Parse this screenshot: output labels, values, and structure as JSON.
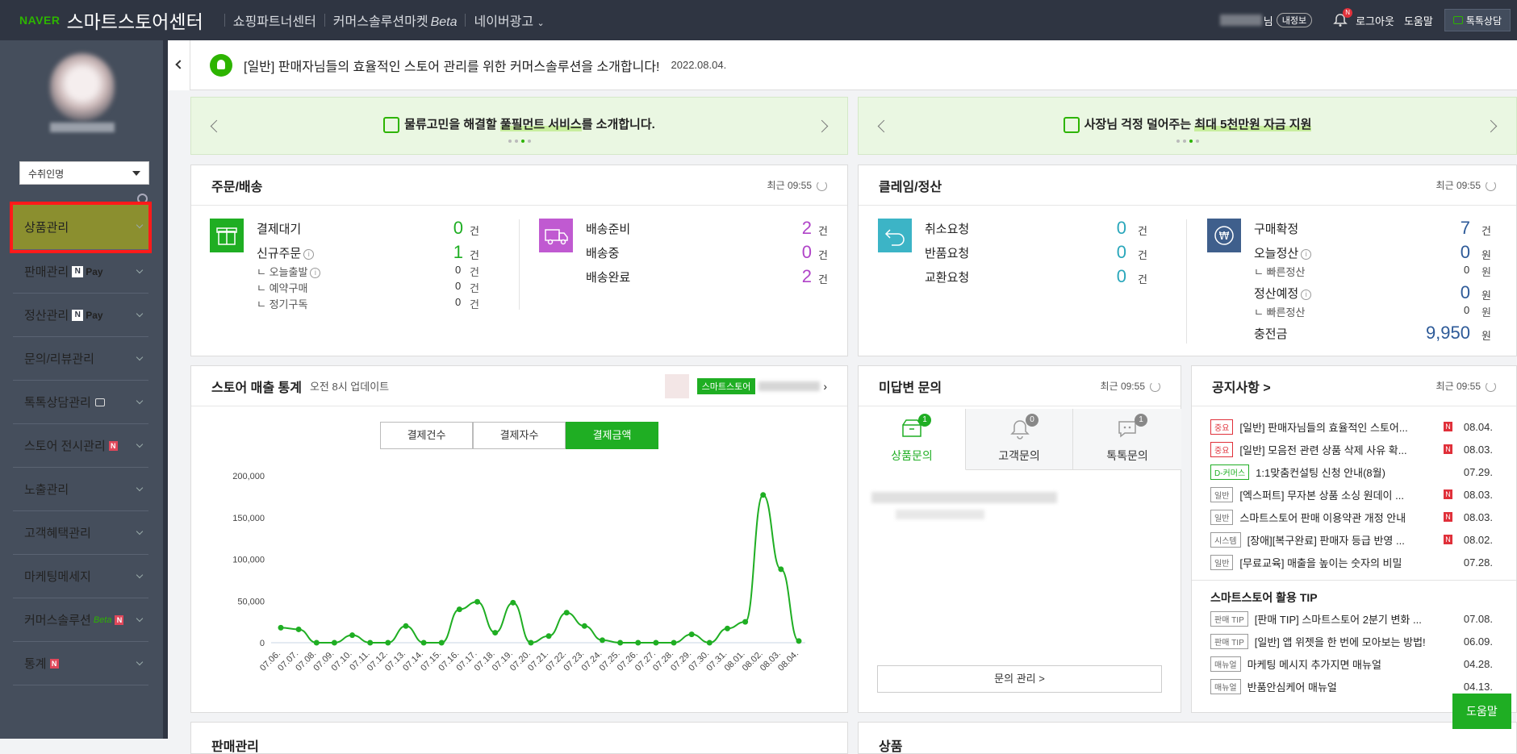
{
  "topbar": {
    "logo": "NAVER",
    "title": "스마트스토어센터",
    "nav": [
      "쇼핑파트너센터",
      "커머스솔루션마켓",
      "네이버광고"
    ],
    "beta": "Beta",
    "user_suffix": "님",
    "my_info": "내정보",
    "bell_badge": "N",
    "logout": "로그아웃",
    "help": "도움말",
    "talk": "톡톡상담"
  },
  "sidebar": {
    "store_select": "수취인명",
    "menu": [
      {
        "label": "상품관리"
      },
      {
        "label": "판매관리",
        "pay": "Pay"
      },
      {
        "label": "정산관리",
        "pay": "Pay"
      },
      {
        "label": "문의/리뷰관리"
      },
      {
        "label": "톡톡상담관리"
      },
      {
        "label": "스토어 전시관리",
        "new": "N"
      },
      {
        "label": "노출관리"
      },
      {
        "label": "고객혜택관리"
      },
      {
        "label": "마케팅메세지"
      },
      {
        "label": "커머스솔루션",
        "beta": "Beta",
        "new": "N"
      },
      {
        "label": "통계",
        "new": "N"
      }
    ],
    "n_badge": "N"
  },
  "notice_bar": {
    "text": "[일반] 판매자님들의 효율적인 스토어 관리를 위한 커머스솔루션을 소개합니다!",
    "date": "2022.08.04."
  },
  "banners": [
    {
      "pre": "물류고민을 해결할 ",
      "hl": "풀필먼트 서비스",
      "post": "를 소개합니다."
    },
    {
      "pre": "사장님 걱정 덜어주는 ",
      "hl": "최대 5천만원 자금 지원",
      "post": ""
    }
  ],
  "orders": {
    "title": "주문/배송",
    "recent": "최근 09:55",
    "payment_wait": {
      "label": "결제대기",
      "value": "0",
      "unit": "건"
    },
    "new_order": {
      "label": "신규주문",
      "value": "1",
      "unit": "건"
    },
    "today_ship": {
      "label": "오늘출발",
      "value": "0",
      "unit": "건"
    },
    "reserve": {
      "label": "예약구매",
      "value": "0",
      "unit": "건"
    },
    "subscription": {
      "label": "정기구독",
      "value": "0",
      "unit": "건"
    },
    "ready": {
      "label": "배송준비",
      "value": "2",
      "unit": "건"
    },
    "shipping": {
      "label": "배송중",
      "value": "0",
      "unit": "건"
    },
    "done": {
      "label": "배송완료",
      "value": "2",
      "unit": "건"
    }
  },
  "claims": {
    "title": "클레임/정산",
    "recent": "최근 09:55",
    "cancel": {
      "label": "취소요청",
      "value": "0",
      "unit": "건"
    },
    "return": {
      "label": "반품요청",
      "value": "0",
      "unit": "건"
    },
    "exchange": {
      "label": "교환요청",
      "value": "0",
      "unit": "건"
    },
    "confirm": {
      "label": "구매확정",
      "value": "7",
      "unit": "건"
    },
    "today_settle": {
      "label": "오늘정산",
      "value": "0",
      "unit": "원"
    },
    "fast1": {
      "label": "빠른정산",
      "value": "0",
      "unit": "원"
    },
    "planned": {
      "label": "정산예정",
      "value": "0",
      "unit": "원"
    },
    "fast2": {
      "label": "빠른정산",
      "value": "0",
      "unit": "원"
    },
    "charge": {
      "label": "충전금",
      "value": "9,950",
      "unit": "원"
    }
  },
  "sales": {
    "title": "스토어 매출 통계",
    "subtitle": "오전 8시 업데이트",
    "store_tag": "스마트스토어",
    "tabs": [
      "결제건수",
      "결제자수",
      "결제금액"
    ],
    "active_tab": 2
  },
  "chart_data": {
    "type": "line",
    "title": "",
    "xlabel": "",
    "ylabel": "",
    "ylim": [
      0,
      200000
    ],
    "yticks": [
      "0",
      "50,000",
      "100,000",
      "150,000",
      "200,000"
    ],
    "ytick_values": [
      0,
      50000,
      100000,
      150000,
      200000
    ],
    "categories": [
      "07.06.",
      "07.07.",
      "07.08.",
      "07.09.",
      "07.10.",
      "07.11.",
      "07.12.",
      "07.13.",
      "07.14.",
      "07.15.",
      "07.16.",
      "07.17.",
      "07.18.",
      "07.19.",
      "07.20.",
      "07.21.",
      "07.22.",
      "07.23.",
      "07.24.",
      "07.25.",
      "07.26.",
      "07.27.",
      "07.28.",
      "07.29.",
      "07.30.",
      "07.31.",
      "08.01.",
      "08.02.",
      "08.03.",
      "08.04."
    ],
    "values": [
      18000,
      16000,
      0,
      0,
      9000,
      0,
      0,
      20000,
      0,
      0,
      40000,
      49000,
      12000,
      48000,
      0,
      8000,
      36000,
      20000,
      3000,
      0,
      0,
      0,
      0,
      10000,
      0,
      17000,
      25000,
      177000,
      88000,
      2000
    ],
    "color": "#1fae23"
  },
  "inquiries": {
    "title": "미답변 문의",
    "recent": "최근 09:55",
    "tabs": [
      {
        "label": "상품문의",
        "count": "1"
      },
      {
        "label": "고객문의",
        "count": "0"
      },
      {
        "label": "톡톡문의",
        "count": "1"
      }
    ],
    "manage": "문의 관리 >"
  },
  "notices": {
    "title": "공지사항 >",
    "recent": "최근 09:55",
    "items": [
      {
        "tag": "중요",
        "tagtype": "red",
        "text": "[일반] 판매자님들의 효율적인 스토어...",
        "new": "N",
        "date": "08.04."
      },
      {
        "tag": "중요",
        "tagtype": "red",
        "text": "[일반] 모음전 관련 상품 삭제 사유 확...",
        "new": "N",
        "date": "08.03."
      },
      {
        "tag": "D-커머스",
        "tagtype": "green",
        "text": "1:1맞춤컨설팅 신청 안내(8월)",
        "new": "",
        "date": "07.29."
      },
      {
        "tag": "일반",
        "tagtype": "gray",
        "text": "[엑스퍼트] 무자본 상품 소싱 원데이 ...",
        "new": "N",
        "date": "08.03."
      },
      {
        "tag": "일반",
        "tagtype": "gray",
        "text": "스마트스토어 판매 이용약관 개정 안내",
        "new": "N",
        "date": "08.03."
      },
      {
        "tag": "시스템",
        "tagtype": "gray",
        "text": "[장애][복구완료] 판매자 등급 반영 ...",
        "new": "N",
        "date": "08.02."
      },
      {
        "tag": "일반",
        "tagtype": "gray",
        "text": "[무료교육] 매출을 높이는 숫자의 비밀",
        "new": "",
        "date": "07.28."
      }
    ],
    "tip_title": "스마트스토어 활용 TIP",
    "tips": [
      {
        "tag": "판매 TIP",
        "text": "[판매 TIP] 스마트스토어 2분기 변화 ...",
        "date": "07.08."
      },
      {
        "tag": "판매 TIP",
        "text": "[일반] 앱 위젯을 한 번에 모아보는 방법!",
        "date": "06.09."
      },
      {
        "tag": "매뉴얼",
        "text": "마케팅 메시지 추가지면 매뉴얼",
        "date": "04.28."
      },
      {
        "tag": "매뉴얼",
        "text": "반품안심케어 매뉴얼",
        "date": "04.13."
      }
    ]
  },
  "help_button": "도움말",
  "bottom_panels": [
    "판매관리",
    "상품"
  ]
}
